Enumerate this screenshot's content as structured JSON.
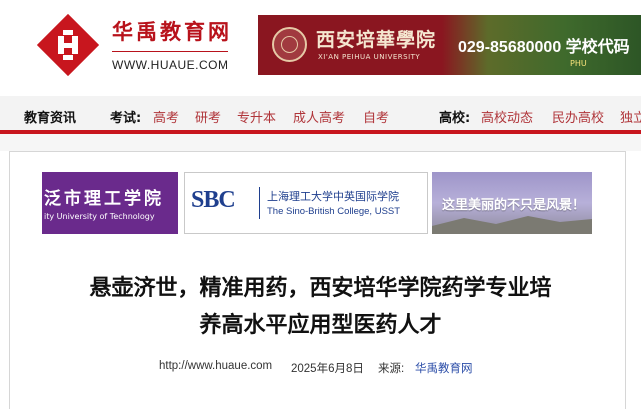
{
  "header": {
    "site_name": "华禹教育网",
    "site_url": "WWW.HUAUE.COM"
  },
  "ad": {
    "school_name": "西安培華學院",
    "school_name_en": "XI'AN PEIHUA UNIVERSITY",
    "phone_text": "029-85680000  学校代码",
    "small_text": "PHU"
  },
  "nav": {
    "home": "教育资讯",
    "exam_label": "考试:",
    "exam_items": [
      "高考",
      "研考",
      "专升本",
      "成人高考",
      "自考"
    ],
    "school_label": "高校:",
    "school_items": [
      "高校动态",
      "民办高校",
      "独立"
    ]
  },
  "logos": {
    "tile1_main": "泛市理工学院",
    "tile1_sub": "ity University of Technology",
    "tile2_sbc": "SBC",
    "tile2_cn": "上海理工大学中英国际学院",
    "tile2_en": "The Sino-British College, USST",
    "tile3_text": "这里美丽的不只是风景！"
  },
  "article": {
    "title_line1": "悬壶济世，精准用药，西安培华学院药学专业培",
    "title_line2": "养高水平应用型医药人才",
    "url": "http://www.huaue.com",
    "date": "2025年6月8日",
    "source_label": "来源:",
    "source": "华禹教育网"
  },
  "colors": {
    "brand_red": "#b8121b",
    "nav_underline": "#c8161e",
    "link_blue": "#2c4ea8"
  }
}
